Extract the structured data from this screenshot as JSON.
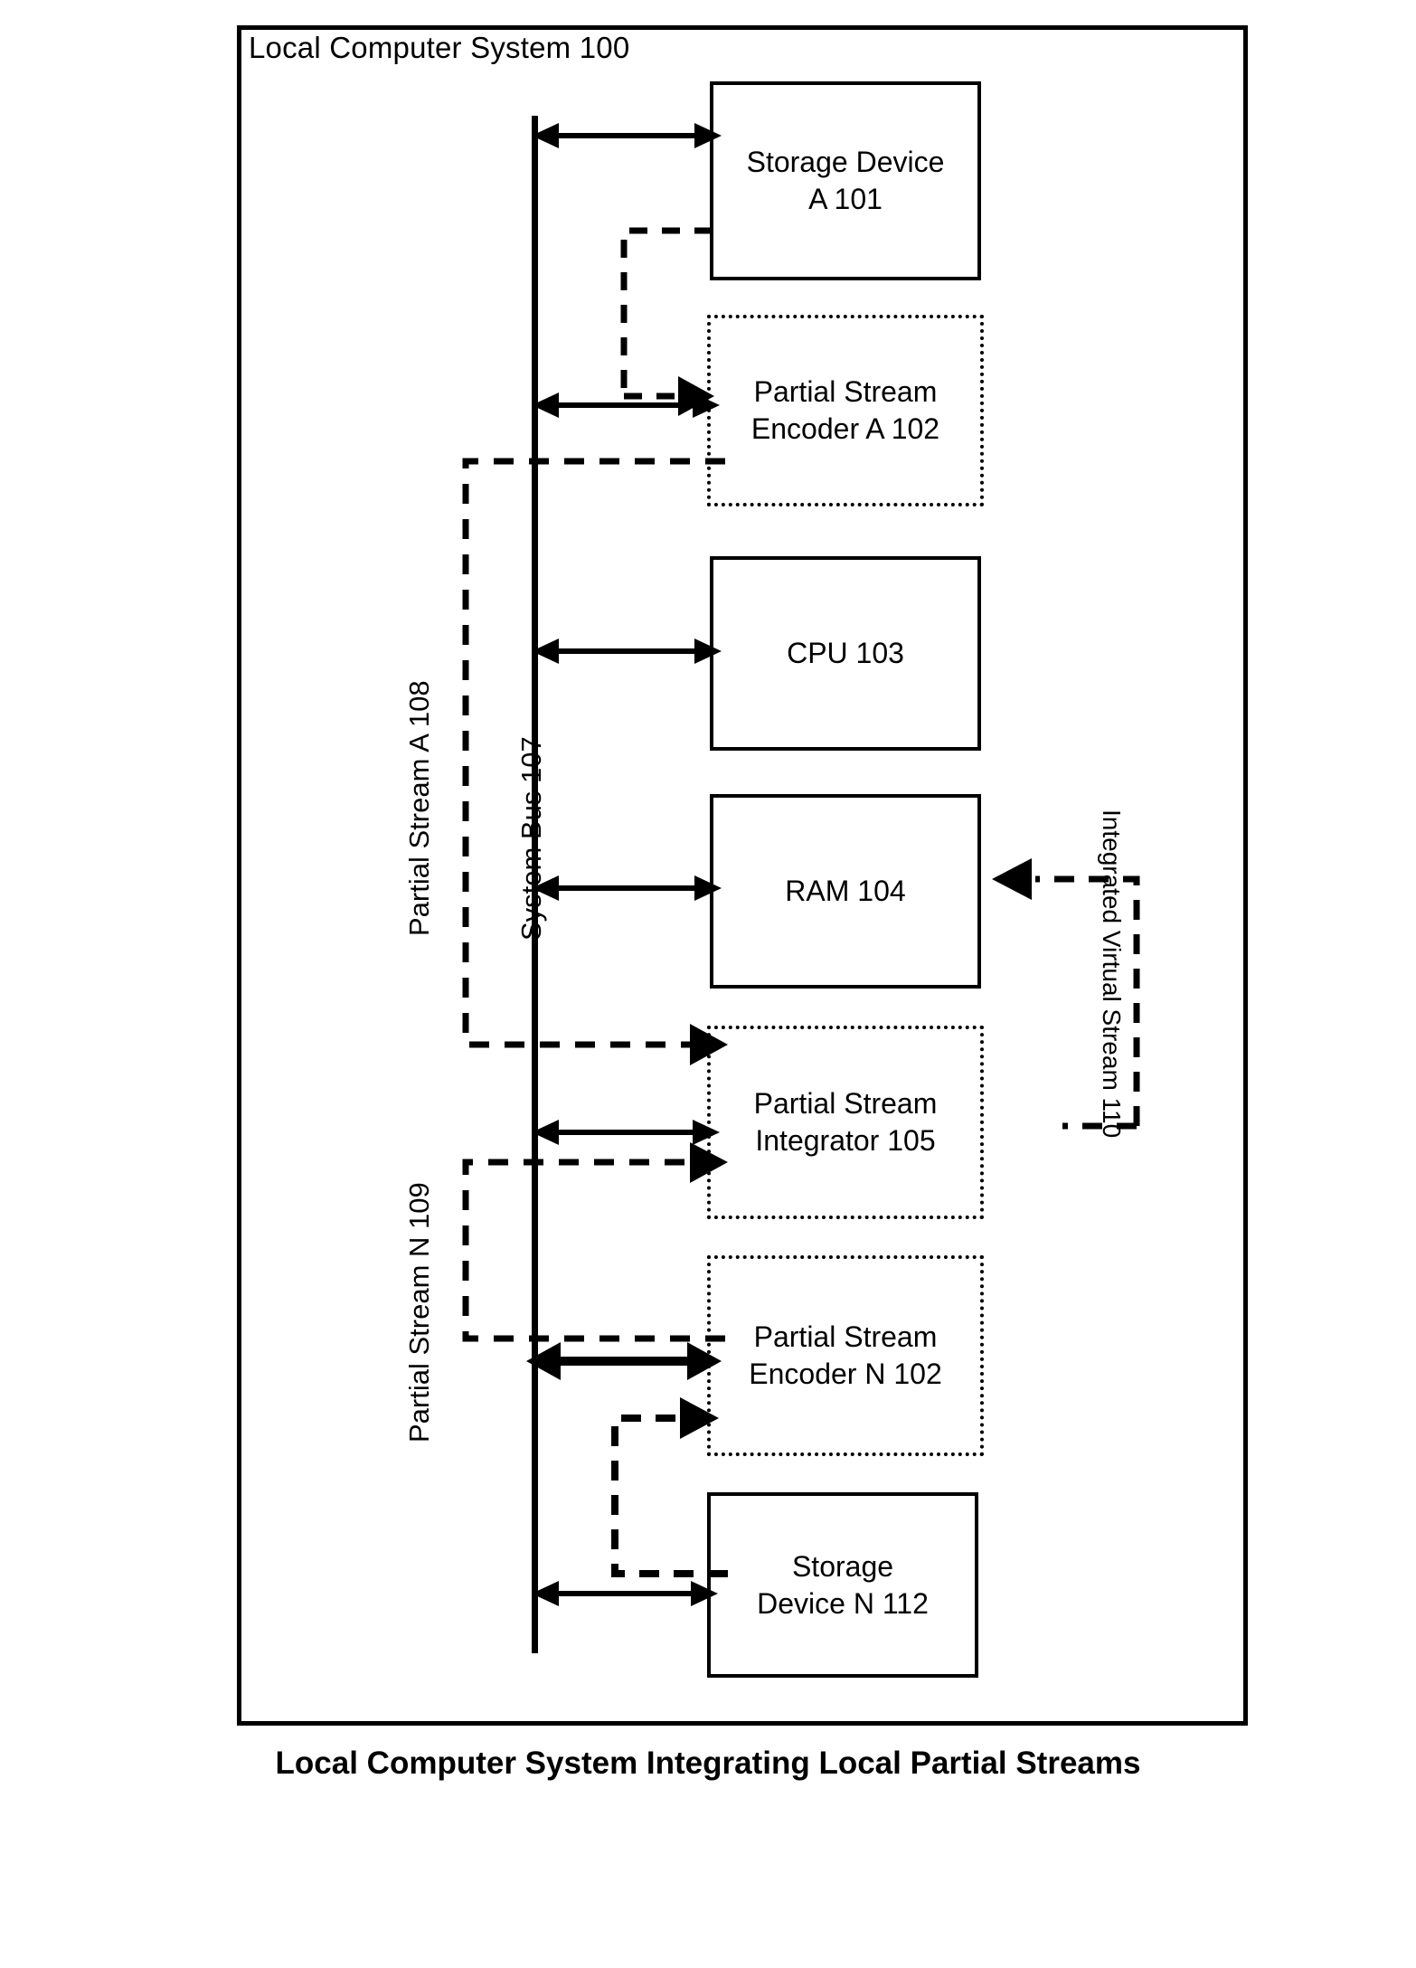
{
  "figure": {
    "frame_title": "Local Computer System 100",
    "caption": "Local Computer System Integrating Local  Partial Streams"
  },
  "bus": {
    "label": "System Bus 107"
  },
  "stream_labels": {
    "partial_stream_a": "Partial Stream A 108",
    "partial_stream_n": "Partial Stream N 109",
    "integrated_virtual_stream": "Integrated Virtual Stream 110"
  },
  "blocks": [
    {
      "id": "storage-device-a",
      "line1": "Storage Device",
      "line2": "A 101",
      "style": "solid"
    },
    {
      "id": "partial-stream-encoder-a",
      "line1": "Partial Stream",
      "line2": "Encoder A 102",
      "style": "dotted"
    },
    {
      "id": "cpu",
      "line1": "CPU 103",
      "line2": "",
      "style": "solid"
    },
    {
      "id": "ram",
      "line1": "RAM 104",
      "line2": "",
      "style": "solid"
    },
    {
      "id": "partial-stream-integrator",
      "line1": "Partial Stream",
      "line2": "Integrator 105",
      "style": "dotted"
    },
    {
      "id": "partial-stream-encoder-n",
      "line1": "Partial Stream",
      "line2": "Encoder N 102",
      "style": "dotted"
    },
    {
      "id": "storage-device-n",
      "line1": "Storage",
      "line2": "Device N 112",
      "style": "solid"
    }
  ],
  "colors": {
    "ink": "#000000",
    "paper": "#ffffff"
  }
}
